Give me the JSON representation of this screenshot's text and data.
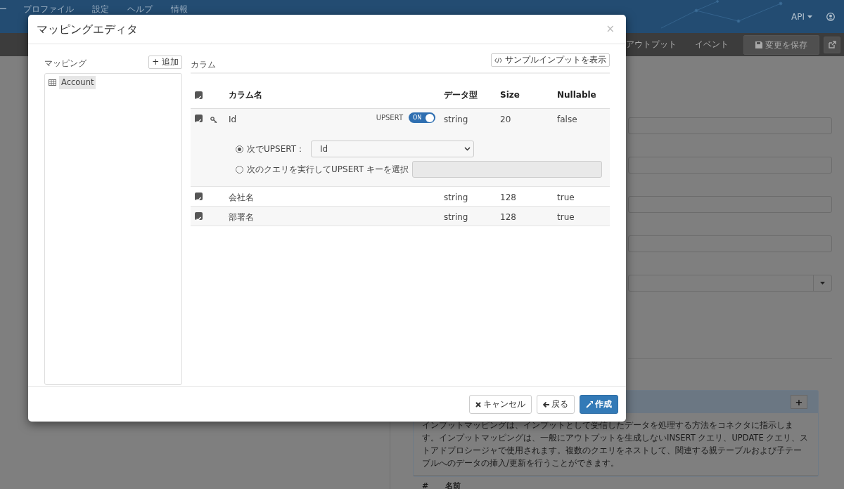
{
  "navbar": {
    "menu_items": [
      {
        "label": "ー"
      },
      {
        "label": "プロファイル"
      },
      {
        "label": "設定"
      },
      {
        "label": "ヘルプ"
      },
      {
        "label": "情報"
      }
    ],
    "api_menu": "API"
  },
  "page_tabs": [
    {
      "label": "アウトプット"
    },
    {
      "label": "イベント"
    }
  ],
  "save_button": "変更を保存",
  "background_form": {
    "fields": [
      {
        "kind": "text"
      },
      {
        "kind": "text"
      },
      {
        "kind": "text"
      },
      {
        "kind": "text"
      },
      {
        "kind": "select"
      }
    ]
  },
  "background_panel": {
    "add_button": "+",
    "description": "インプットマッピングは、インプットとして受信したデータを処理する方法をコネクタに指示します。インプットマッピングは、一般にアウトプットを生成しないINSERT クエリ、UPDATE クエリ、ストアドプロシージャで使用されます。複数のクエリをネストして、関連する親テーブルおよび子テーブルへのデータの挿入/更新を行うことができます。",
    "table_columns": [
      "#",
      "名前"
    ]
  },
  "modal": {
    "title": "マッピングエディタ",
    "close_button": "×",
    "mapping_label": "マッピング",
    "add_button": "+ 追加",
    "tree": [
      {
        "label": "Account",
        "selected": true
      }
    ],
    "columns_label": "カラム",
    "sample_button": "サンプルインプットを表示",
    "table": {
      "all_checked": true,
      "columns": [
        "カラム名",
        "データ型",
        "Size",
        "Nullable"
      ],
      "rows": [
        {
          "checked": true,
          "key": true,
          "name": "Id",
          "upsert": {
            "label": "UPSERT",
            "on": true,
            "switch_text": "ON"
          },
          "type": "string",
          "size": "20",
          "nullable": "false",
          "expanded": true,
          "options": [
            {
              "kind": "select",
              "label": "次でUPSERT：",
              "selected": true,
              "value": "Id"
            },
            {
              "kind": "text",
              "label": "次のクエリを実行してUPSERT キーを選択",
              "selected": false,
              "disabled": true
            }
          ]
        },
        {
          "checked": true,
          "key": false,
          "name": "会社名",
          "type": "string",
          "size": "128",
          "nullable": "true",
          "expanded": false
        },
        {
          "checked": true,
          "key": false,
          "name": "部署名",
          "type": "string",
          "size": "128",
          "nullable": "true",
          "expanded": false
        }
      ]
    },
    "footer_buttons": [
      {
        "kind": "cancel",
        "label": "キャンセル"
      },
      {
        "kind": "back",
        "label": "戻る"
      },
      {
        "kind": "create",
        "label": "作成"
      }
    ]
  }
}
